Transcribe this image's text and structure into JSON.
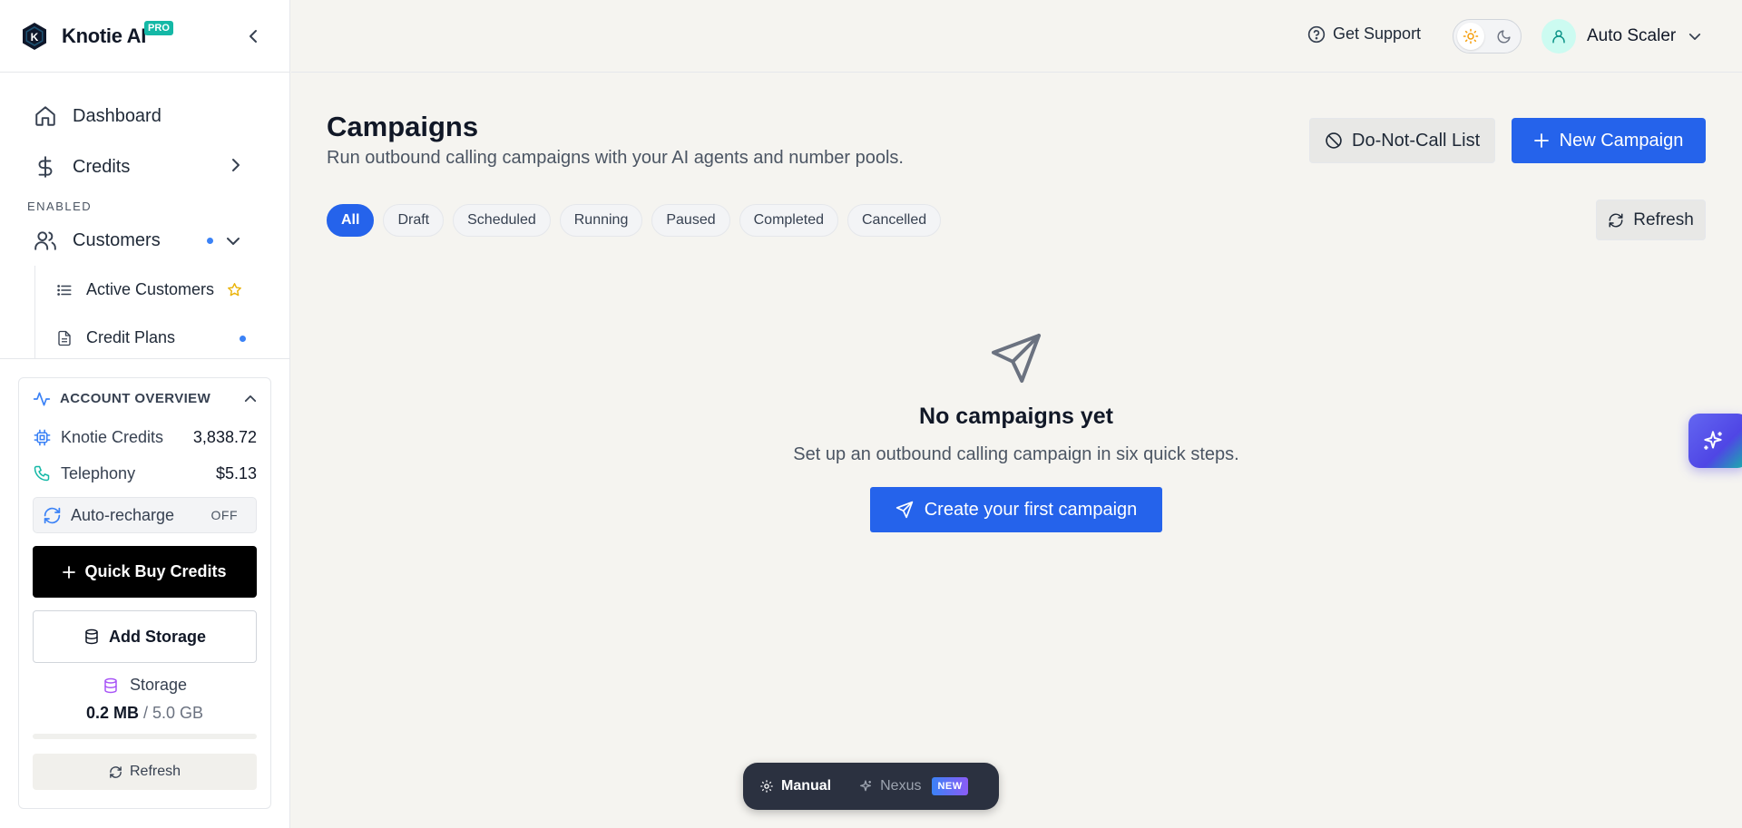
{
  "brand": {
    "name": "Knotie AI",
    "badge": "PRO"
  },
  "sidebar": {
    "nav": [
      {
        "label": "Dashboard",
        "icon": "home-icon"
      },
      {
        "label": "Credits",
        "icon": "dollar-icon"
      }
    ],
    "section_label": "ENABLED",
    "customers": {
      "label": "Customers",
      "icon": "users-icon",
      "children": [
        {
          "label": "Active Customers",
          "icon": "list-icon",
          "marker": "star-icon"
        },
        {
          "label": "Credit Plans",
          "icon": "file-icon",
          "marker": "dot"
        }
      ]
    },
    "account": {
      "title": "ACCOUNT OVERVIEW",
      "knotie_credits_label": "Knotie Credits",
      "knotie_credits_value": "3,838.72",
      "telephony_label": "Telephony",
      "telephony_value": "$5.13",
      "auto_recharge_label": "Auto-recharge",
      "auto_recharge_state": "OFF",
      "quick_buy_label": "Quick Buy Credits",
      "add_storage_label": "Add Storage",
      "storage_label": "Storage",
      "storage_used": "0.2 MB",
      "storage_sep": " / ",
      "storage_total": "5.0 GB",
      "storage_fraction": 4e-05,
      "refresh_label": "Refresh"
    }
  },
  "topbar": {
    "support_label": "Get Support",
    "user_name": "Auto Scaler"
  },
  "main": {
    "title": "Campaigns",
    "subtitle": "Run outbound calling campaigns with your AI agents and number pools.",
    "dnc_label": "Do-Not-Call List",
    "new_campaign_label": "New Campaign",
    "refresh_label": "Refresh",
    "filters": [
      "All",
      "Draft",
      "Scheduled",
      "Running",
      "Paused",
      "Completed",
      "Cancelled"
    ],
    "active_filter": "All",
    "empty": {
      "title": "No campaigns yet",
      "subtitle": "Set up an outbound calling campaign in six quick steps.",
      "cta": "Create your first campaign"
    }
  },
  "mode_switch": {
    "manual_label": "Manual",
    "nexus_label": "Nexus",
    "nexus_badge": "NEW"
  },
  "colors": {
    "accent": "#2563eb",
    "brand_badge": "#14b8a6",
    "background": "#f5f4f0"
  }
}
